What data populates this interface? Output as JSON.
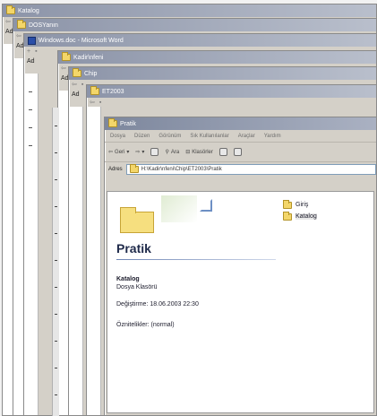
{
  "windows": {
    "w1": {
      "title": "Katalog"
    },
    "w2": {
      "title": "DOSYanın"
    },
    "w3": {
      "title": "Windows.doc - Microsoft Word"
    },
    "w4": {
      "title": "Kadir\\nfeni"
    },
    "w5": {
      "title": "Chip"
    },
    "w6": {
      "title": "ET2003"
    },
    "w7": {
      "title": "Pratik"
    }
  },
  "stack": {
    "adres_short": "Ad",
    "adres_short2": "Ad",
    "adres_short3": "Ad",
    "adres_short4": "Ad",
    "adres_short5": "Ad"
  },
  "menu": [
    "Dosya",
    "Düzen",
    "Görünüm",
    "Sık Kullanılanlar",
    "Araçlar",
    "Yardım"
  ],
  "toolbar": {
    "back": "Geri",
    "search": "Ara",
    "folders": "Klasörler"
  },
  "address": {
    "label": "Adres",
    "path": "H:\\Kadir\\nfeni\\Chip\\ET2003\\Pratik"
  },
  "folder_view": {
    "title": "Pratik",
    "selected_name": "Katalog",
    "selected_type": "Dosya Klasörü",
    "modified": "Değiştirme: 18.06.2003 22:30",
    "attributes": "Öznitelikler: (normal)"
  },
  "files": [
    {
      "name": "Giriş"
    },
    {
      "name": "Katalog"
    }
  ]
}
